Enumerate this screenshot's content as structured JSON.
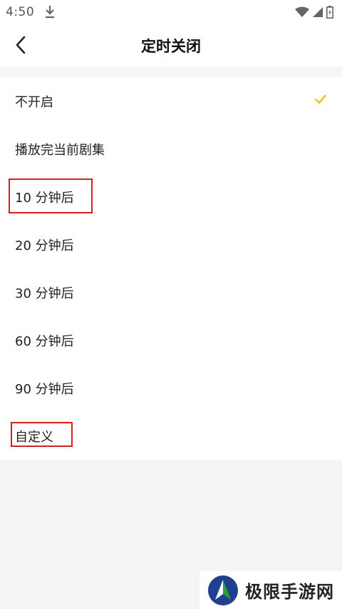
{
  "status_bar": {
    "time": "4:50"
  },
  "app_bar": {
    "title": "定时关闭"
  },
  "options": [
    {
      "label": "不开启",
      "selected": true
    },
    {
      "label": "播放完当前剧集",
      "selected": false
    },
    {
      "label": "10 分钟后",
      "selected": false
    },
    {
      "label": "20 分钟后",
      "selected": false
    },
    {
      "label": "30 分钟后",
      "selected": false
    },
    {
      "label": "60 分钟后",
      "selected": false
    },
    {
      "label": "90 分钟后",
      "selected": false
    },
    {
      "label": "自定义",
      "selected": false
    }
  ],
  "watermark": {
    "text": "极限手游网"
  },
  "colors": {
    "accent_check": "#f5c518",
    "highlight_box": "#d81e1e",
    "logo_blue": "#1f3f8f",
    "logo_green": "#2e9e3a"
  }
}
